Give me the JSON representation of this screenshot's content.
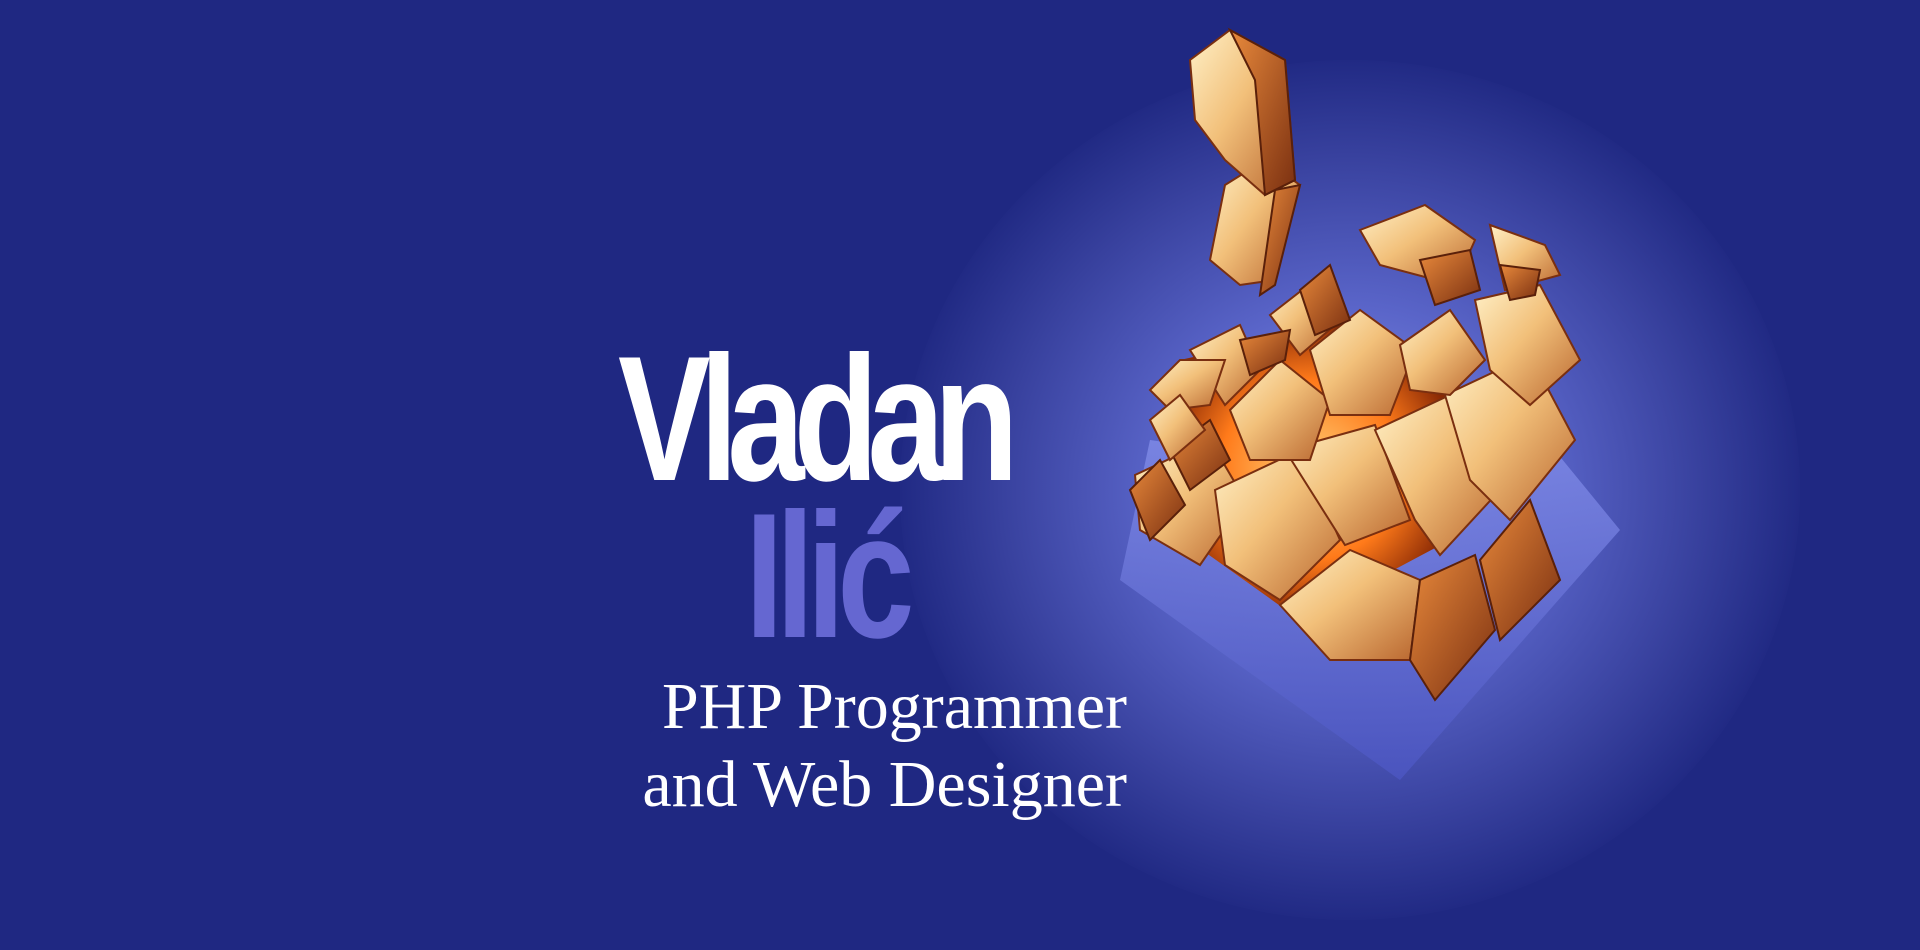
{
  "colors": {
    "background": "#1f2882",
    "name_first": "#ffffff",
    "name_last": "#6567d1",
    "tagline": "#ffffff",
    "accent_gold": "#f2c07a",
    "accent_glow": "#ff7a1a"
  },
  "hero": {
    "first_name": "Vladan",
    "last_name": "Ilić",
    "tagline_line1": "PHP Programmer",
    "tagline_line2": "and Web Designer"
  },
  "artwork": {
    "icon": "shattered-gold-cube-icon"
  }
}
